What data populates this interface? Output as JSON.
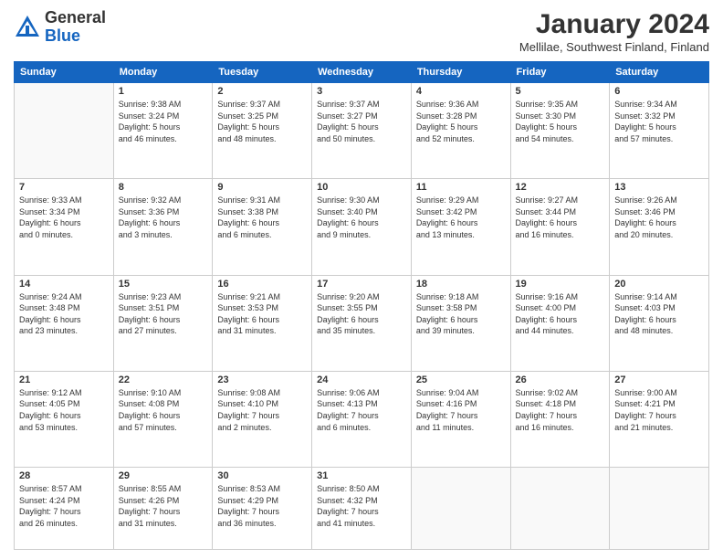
{
  "header": {
    "logo": {
      "general": "General",
      "blue": "Blue"
    },
    "title": "January 2024",
    "location": "Mellilae, Southwest Finland, Finland"
  },
  "days_of_week": [
    "Sunday",
    "Monday",
    "Tuesday",
    "Wednesday",
    "Thursday",
    "Friday",
    "Saturday"
  ],
  "weeks": [
    [
      {
        "day": "",
        "info": ""
      },
      {
        "day": "1",
        "info": "Sunrise: 9:38 AM\nSunset: 3:24 PM\nDaylight: 5 hours\nand 46 minutes."
      },
      {
        "day": "2",
        "info": "Sunrise: 9:37 AM\nSunset: 3:25 PM\nDaylight: 5 hours\nand 48 minutes."
      },
      {
        "day": "3",
        "info": "Sunrise: 9:37 AM\nSunset: 3:27 PM\nDaylight: 5 hours\nand 50 minutes."
      },
      {
        "day": "4",
        "info": "Sunrise: 9:36 AM\nSunset: 3:28 PM\nDaylight: 5 hours\nand 52 minutes."
      },
      {
        "day": "5",
        "info": "Sunrise: 9:35 AM\nSunset: 3:30 PM\nDaylight: 5 hours\nand 54 minutes."
      },
      {
        "day": "6",
        "info": "Sunrise: 9:34 AM\nSunset: 3:32 PM\nDaylight: 5 hours\nand 57 minutes."
      }
    ],
    [
      {
        "day": "7",
        "info": "Sunrise: 9:33 AM\nSunset: 3:34 PM\nDaylight: 6 hours\nand 0 minutes."
      },
      {
        "day": "8",
        "info": "Sunrise: 9:32 AM\nSunset: 3:36 PM\nDaylight: 6 hours\nand 3 minutes."
      },
      {
        "day": "9",
        "info": "Sunrise: 9:31 AM\nSunset: 3:38 PM\nDaylight: 6 hours\nand 6 minutes."
      },
      {
        "day": "10",
        "info": "Sunrise: 9:30 AM\nSunset: 3:40 PM\nDaylight: 6 hours\nand 9 minutes."
      },
      {
        "day": "11",
        "info": "Sunrise: 9:29 AM\nSunset: 3:42 PM\nDaylight: 6 hours\nand 13 minutes."
      },
      {
        "day": "12",
        "info": "Sunrise: 9:27 AM\nSunset: 3:44 PM\nDaylight: 6 hours\nand 16 minutes."
      },
      {
        "day": "13",
        "info": "Sunrise: 9:26 AM\nSunset: 3:46 PM\nDaylight: 6 hours\nand 20 minutes."
      }
    ],
    [
      {
        "day": "14",
        "info": "Sunrise: 9:24 AM\nSunset: 3:48 PM\nDaylight: 6 hours\nand 23 minutes."
      },
      {
        "day": "15",
        "info": "Sunrise: 9:23 AM\nSunset: 3:51 PM\nDaylight: 6 hours\nand 27 minutes."
      },
      {
        "day": "16",
        "info": "Sunrise: 9:21 AM\nSunset: 3:53 PM\nDaylight: 6 hours\nand 31 minutes."
      },
      {
        "day": "17",
        "info": "Sunrise: 9:20 AM\nSunset: 3:55 PM\nDaylight: 6 hours\nand 35 minutes."
      },
      {
        "day": "18",
        "info": "Sunrise: 9:18 AM\nSunset: 3:58 PM\nDaylight: 6 hours\nand 39 minutes."
      },
      {
        "day": "19",
        "info": "Sunrise: 9:16 AM\nSunset: 4:00 PM\nDaylight: 6 hours\nand 44 minutes."
      },
      {
        "day": "20",
        "info": "Sunrise: 9:14 AM\nSunset: 4:03 PM\nDaylight: 6 hours\nand 48 minutes."
      }
    ],
    [
      {
        "day": "21",
        "info": "Sunrise: 9:12 AM\nSunset: 4:05 PM\nDaylight: 6 hours\nand 53 minutes."
      },
      {
        "day": "22",
        "info": "Sunrise: 9:10 AM\nSunset: 4:08 PM\nDaylight: 6 hours\nand 57 minutes."
      },
      {
        "day": "23",
        "info": "Sunrise: 9:08 AM\nSunset: 4:10 PM\nDaylight: 7 hours\nand 2 minutes."
      },
      {
        "day": "24",
        "info": "Sunrise: 9:06 AM\nSunset: 4:13 PM\nDaylight: 7 hours\nand 6 minutes."
      },
      {
        "day": "25",
        "info": "Sunrise: 9:04 AM\nSunset: 4:16 PM\nDaylight: 7 hours\nand 11 minutes."
      },
      {
        "day": "26",
        "info": "Sunrise: 9:02 AM\nSunset: 4:18 PM\nDaylight: 7 hours\nand 16 minutes."
      },
      {
        "day": "27",
        "info": "Sunrise: 9:00 AM\nSunset: 4:21 PM\nDaylight: 7 hours\nand 21 minutes."
      }
    ],
    [
      {
        "day": "28",
        "info": "Sunrise: 8:57 AM\nSunset: 4:24 PM\nDaylight: 7 hours\nand 26 minutes."
      },
      {
        "day": "29",
        "info": "Sunrise: 8:55 AM\nSunset: 4:26 PM\nDaylight: 7 hours\nand 31 minutes."
      },
      {
        "day": "30",
        "info": "Sunrise: 8:53 AM\nSunset: 4:29 PM\nDaylight: 7 hours\nand 36 minutes."
      },
      {
        "day": "31",
        "info": "Sunrise: 8:50 AM\nSunset: 4:32 PM\nDaylight: 7 hours\nand 41 minutes."
      },
      {
        "day": "",
        "info": ""
      },
      {
        "day": "",
        "info": ""
      },
      {
        "day": "",
        "info": ""
      }
    ]
  ]
}
